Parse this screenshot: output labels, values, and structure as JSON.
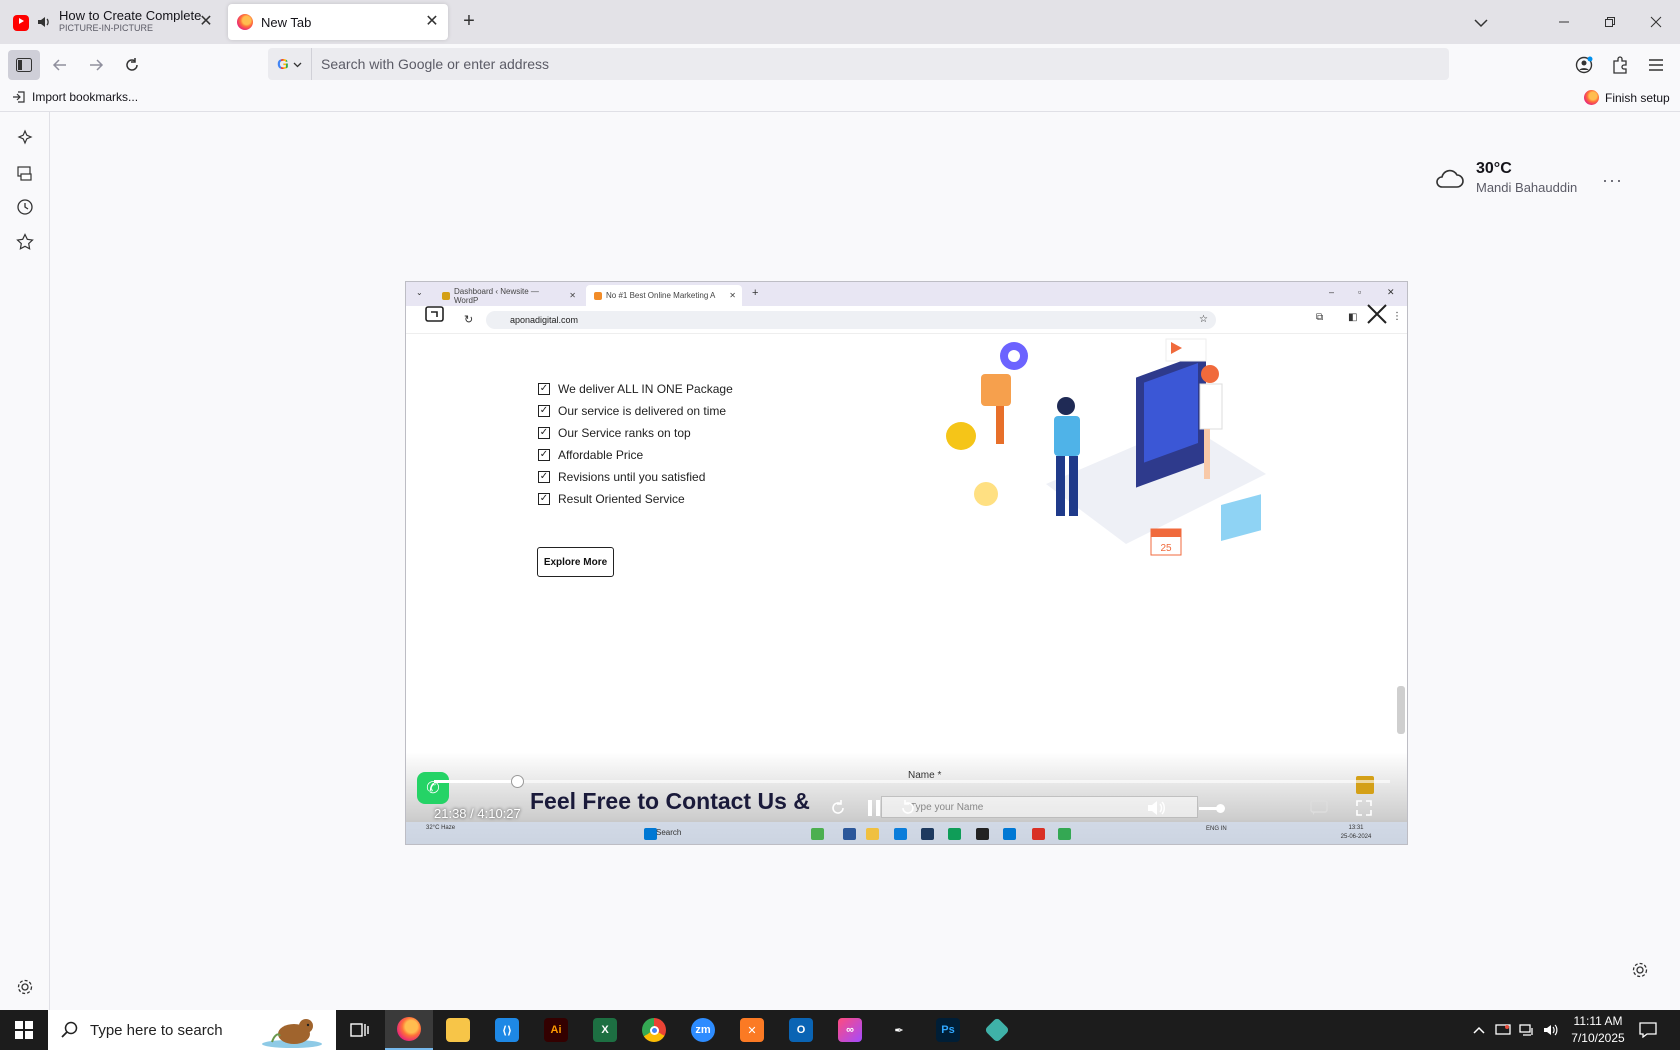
{
  "browser": {
    "tabs": [
      {
        "title": "How to Create Complete W",
        "subtitle": "PICTURE-IN-PICTURE",
        "icon": "youtube-icon"
      },
      {
        "title": "New Tab",
        "icon": "firefox-icon"
      }
    ],
    "urlbar": {
      "placeholder": "Search with Google or enter address",
      "engine": "G"
    },
    "bookmarks": {
      "import_label": "Import bookmarks...",
      "finish_setup_label": "Finish setup"
    }
  },
  "newtab": {
    "weather": {
      "temp": "30°C",
      "location": "Mandi Bahauddin",
      "more": "···"
    }
  },
  "pip": {
    "tabs": [
      "Dashboard ‹ Newsite — WordP",
      "No #1 Best Online Marketing A"
    ],
    "url": "aponadigital.com",
    "checklist": [
      "We deliver ALL IN ONE Package",
      "Our service is delivered on time",
      "Our Service ranks on top",
      "Affordable Price",
      "Revisions until you satisfied",
      "Result Oriented Service"
    ],
    "explore_label": "Explore More",
    "heading": "Feel Free to Contact Us &",
    "name_label": "Name *",
    "name_placeholder": "Type your Name",
    "time": "21:38 / 4:10:27",
    "progress_fraction": 0.0864,
    "inner_taskbar": {
      "search": "Search",
      "clock_time": "13:31",
      "clock_date": "25-06-2024",
      "weather": "32°C Haze",
      "lang": "ENG IN"
    }
  },
  "taskbar": {
    "search_placeholder": "Type here to search",
    "apps": [
      "task-view",
      "firefox",
      "file-explorer",
      "vscode",
      "illustrator",
      "excel",
      "chrome",
      "zoom",
      "xampp",
      "outlook",
      "creative-cloud",
      "pen-tool",
      "photoshop",
      "app"
    ],
    "clock": {
      "time": "11:11 AM",
      "date": "7/10/2025"
    }
  },
  "colors": {
    "accent": "#0060df",
    "taskbar": "#1c1c1c",
    "tabstrip": "#e3e2e7"
  }
}
